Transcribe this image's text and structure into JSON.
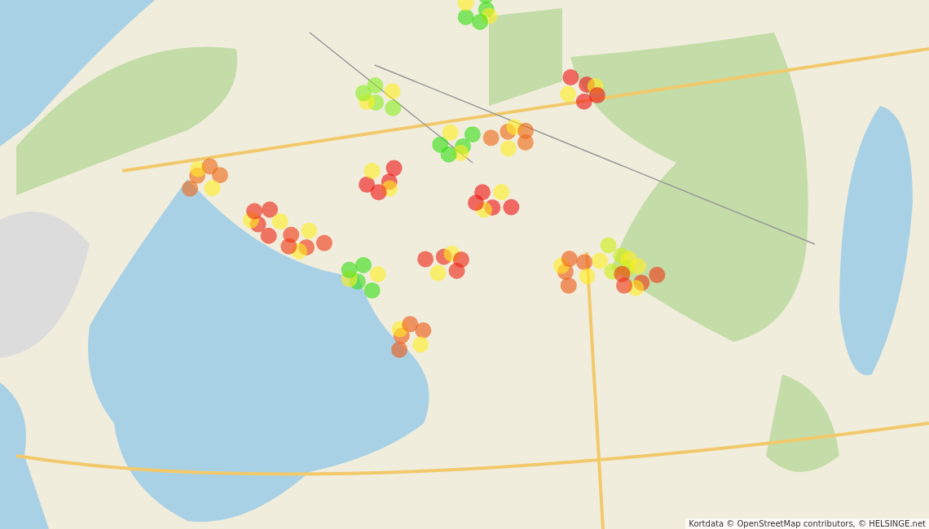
{
  "attribution": "Kortdata © OpenStreetMap contributors, © HELSINGE.net"
}
